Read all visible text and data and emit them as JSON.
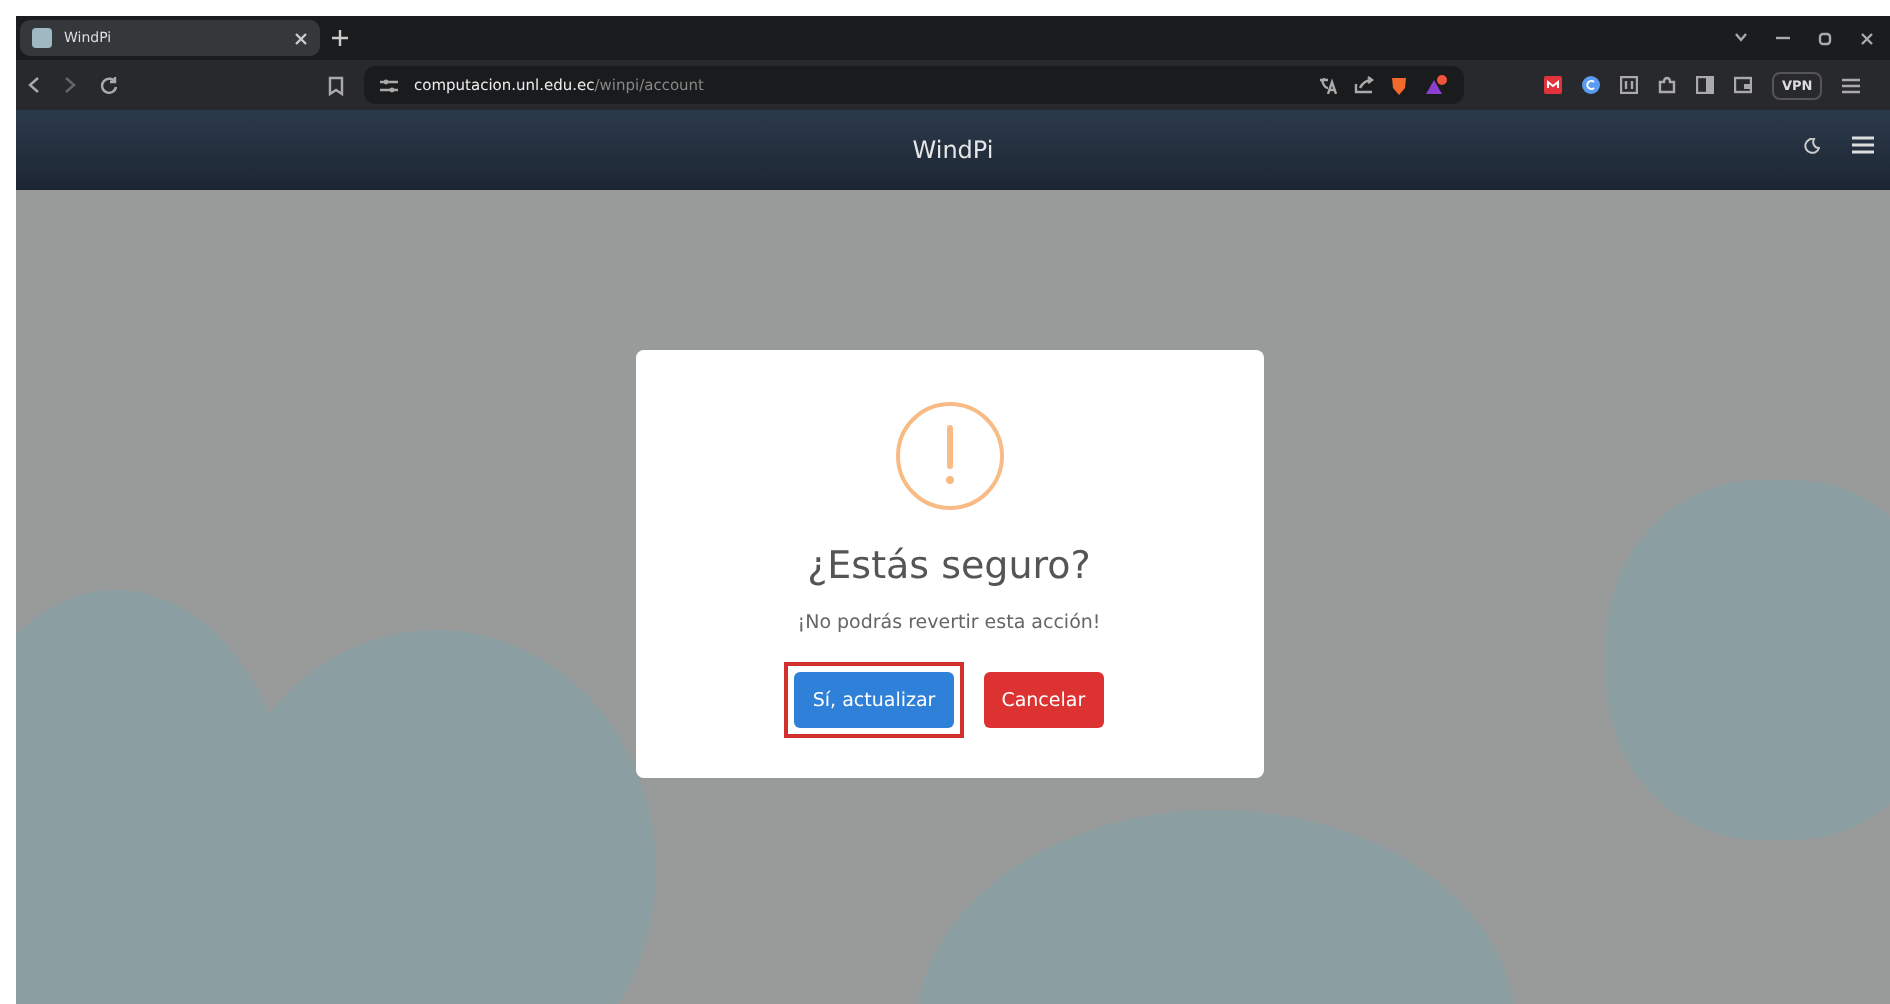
{
  "browser": {
    "tabs": [
      {
        "title": "WindPi",
        "selected": true
      }
    ],
    "address": {
      "host": "computacion.unl.edu.ec",
      "path": "/winpi/account"
    },
    "vpn_label": "VPN"
  },
  "app": {
    "title": "WindPi"
  },
  "dialog": {
    "title": "¿Estás seguro?",
    "message": "¡No podrás revertir esta acción!",
    "buttons": [
      {
        "label": "Sí, actualizar",
        "kind": "confirm",
        "highlighted": true
      },
      {
        "label": "Cancelar",
        "kind": "cancel",
        "highlighted": false
      }
    ]
  }
}
